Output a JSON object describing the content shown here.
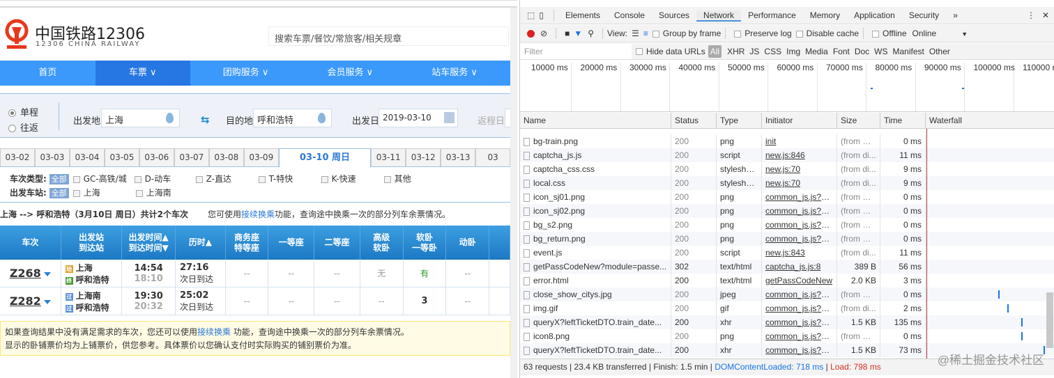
{
  "site": {
    "title": "中国铁路12306",
    "subtitle": "12306 CHINA RAILWAY",
    "search_placeholder": "搜索车票/餐饮/常旅客/相关规章",
    "brand_color": "#3b99fc",
    "nav": [
      {
        "label": "首页"
      },
      {
        "label": "车票 ∨",
        "active": true
      },
      {
        "label": "团购服务 ∨"
      },
      {
        "label": "会员服务 ∨"
      },
      {
        "label": "站车服务 ∨"
      }
    ],
    "query": {
      "one_way": "单程",
      "round_trip": "往返",
      "from_label": "出发地",
      "from_value": "上海",
      "to_label": "目的地",
      "to_value": "呼和浩特",
      "date_label": "出发日",
      "date_value": "2019-03-10",
      "return_label": "返程日"
    },
    "dates": [
      "03-02",
      "03-03",
      "03-04",
      "03-05",
      "03-06",
      "03-07",
      "03-08",
      "03-09",
      "03-10 周日",
      "03-11",
      "03-12",
      "03-13",
      "03"
    ],
    "active_date": "03-10 周日",
    "filters": {
      "type_label": "车次类型:",
      "all": "全部",
      "types": [
        "GC-高铁/城",
        "D-动车",
        "Z-直达",
        "T-特快",
        "K-快速",
        "其他"
      ],
      "station_label": "出发车站:",
      "stations": [
        "上海",
        "上海南"
      ]
    },
    "summary": {
      "text": "上海 --> 呼和浩特（3月10日  周日）共计2个车次",
      "hint_pre": "您可使用",
      "hint_link": "接续换乘",
      "hint_post": "功能，查询途中换乘一次的部分列车余票情况。"
    },
    "table": {
      "headers": [
        "车次",
        "出发站\n到达站",
        "出发时间▲\n到达时间▼",
        "历时▲",
        "商务座\n特等座",
        "一等座",
        "二等座",
        "高级\n软卧",
        "软卧\n一等卧",
        "动卧",
        ""
      ],
      "rows": [
        {
          "no": "Z268",
          "from_badge": "始",
          "from": "上海",
          "to_badge": "终",
          "to": "呼和浩特",
          "dep": "14:54",
          "arr": "18:10",
          "dur": "27:16",
          "day": "次日到达",
          "seats": [
            "--",
            "--",
            "--",
            "无",
            "有",
            "--"
          ]
        },
        {
          "no": "Z282",
          "from_badge": "过",
          "from": "上海南",
          "to_badge": "过",
          "to": "呼和浩特",
          "dep": "19:30",
          "arr": "20:32",
          "dur": "25:02",
          "day": "次日到达",
          "seats": [
            "--",
            "--",
            "--",
            "--",
            "3",
            "--"
          ]
        }
      ]
    },
    "notice": {
      "line1_pre": "如果查询结果中没有满足需求的车次，您还可以使用",
      "line1_link": "接续换乘",
      "line1_post": " 功能，查询途中换乘一次的部分列车余票情况。",
      "line2": "显示的卧铺票价均为上铺票价，供您参考。具体票价以您确认支付时实际购买的铺别票价为准。"
    }
  },
  "devtools": {
    "tabs": [
      "Elements",
      "Console",
      "Sources",
      "Network",
      "Performance",
      "Memory",
      "Application",
      "Security",
      "»"
    ],
    "active_tab": "Network",
    "toolbar": {
      "view": "View:",
      "group_by_frame": "Group by frame",
      "preserve_log": "Preserve log",
      "disable_cache": "Disable cache",
      "offline": "Offline",
      "throttle": "Online"
    },
    "filter": {
      "placeholder": "Filter",
      "hide_data_urls": "Hide data URLs",
      "types": [
        "All",
        "XHR",
        "JS",
        "CSS",
        "Img",
        "Media",
        "Font",
        "Doc",
        "WS",
        "Manifest",
        "Other"
      ]
    },
    "timeline": [
      "10000 ms",
      "20000 ms",
      "30000 ms",
      "40000 ms",
      "50000 ms",
      "60000 ms",
      "70000 ms",
      "80000 ms",
      "90000 ms",
      "100000 ms",
      "110000 ms"
    ],
    "columns": [
      "Name",
      "Status",
      "Type",
      "Initiator",
      "Size",
      "Time",
      "Waterfall"
    ],
    "rows": [
      [
        "bg-train.png",
        "200",
        "png",
        "init",
        "(from m...",
        "0 ms"
      ],
      [
        "captcha_js.js",
        "200",
        "script",
        "new.js:846",
        "(from di...",
        "11 ms"
      ],
      [
        "captcha_css.css",
        "200",
        "stylesheet",
        "new.js:70",
        "(from di...",
        "9 ms"
      ],
      [
        "local.css",
        "200",
        "stylesheet",
        "new.js:70",
        "(from di...",
        "9 ms"
      ],
      [
        "icon_sj01.png",
        "200",
        "png",
        "common_js.js?sc...",
        "(from m...",
        "0 ms"
      ],
      [
        "icon_sj02.png",
        "200",
        "png",
        "common_js.js?sc...",
        "(from m...",
        "0 ms"
      ],
      [
        "bg_s2.png",
        "200",
        "png",
        "common_js.js?sc...",
        "(from m...",
        "0 ms"
      ],
      [
        "bg_return.png",
        "200",
        "png",
        "common_js.js?sc...",
        "(from m...",
        "0 ms"
      ],
      [
        "event.js",
        "200",
        "script",
        "new.js:843",
        "(from di...",
        "11 ms"
      ],
      [
        "getPassCodeNew?module=passe...",
        "302",
        "text/html",
        "captcha_js.js:8",
        "389 B",
        "56 ms"
      ],
      [
        "error.html",
        "200",
        "text/html",
        "getPassCodeNew",
        "2.0 KB",
        "3 ms"
      ],
      [
        "close_show_citys.jpg",
        "200",
        "jpeg",
        "common_js.js?sc...",
        "(from m...",
        "0 ms"
      ],
      [
        "img.gif",
        "200",
        "gif",
        "common_js.js?sc...",
        "(from di...",
        "2 ms"
      ],
      [
        "queryX?leftTicketDTO.train_date...",
        "200",
        "xhr",
        "common_js.js?sc...",
        "1.5 KB",
        "135 ms"
      ],
      [
        "icon8.png",
        "200",
        "png",
        "common_js.js?sc...",
        "(from m...",
        "0 ms"
      ],
      [
        "queryX?leftTicketDTO.train_date...",
        "200",
        "xhr",
        "common_js.js?sc...",
        "1.5 KB",
        "73 ms"
      ]
    ],
    "status": {
      "requests": "63 requests",
      "transferred": "23.4 KB transferred",
      "finish": "Finish: 1.5 min",
      "dcl": "DOMContentLoaded: 718 ms",
      "load": "Load: 798 ms"
    },
    "watermark": "@稀土掘金技术社区"
  }
}
